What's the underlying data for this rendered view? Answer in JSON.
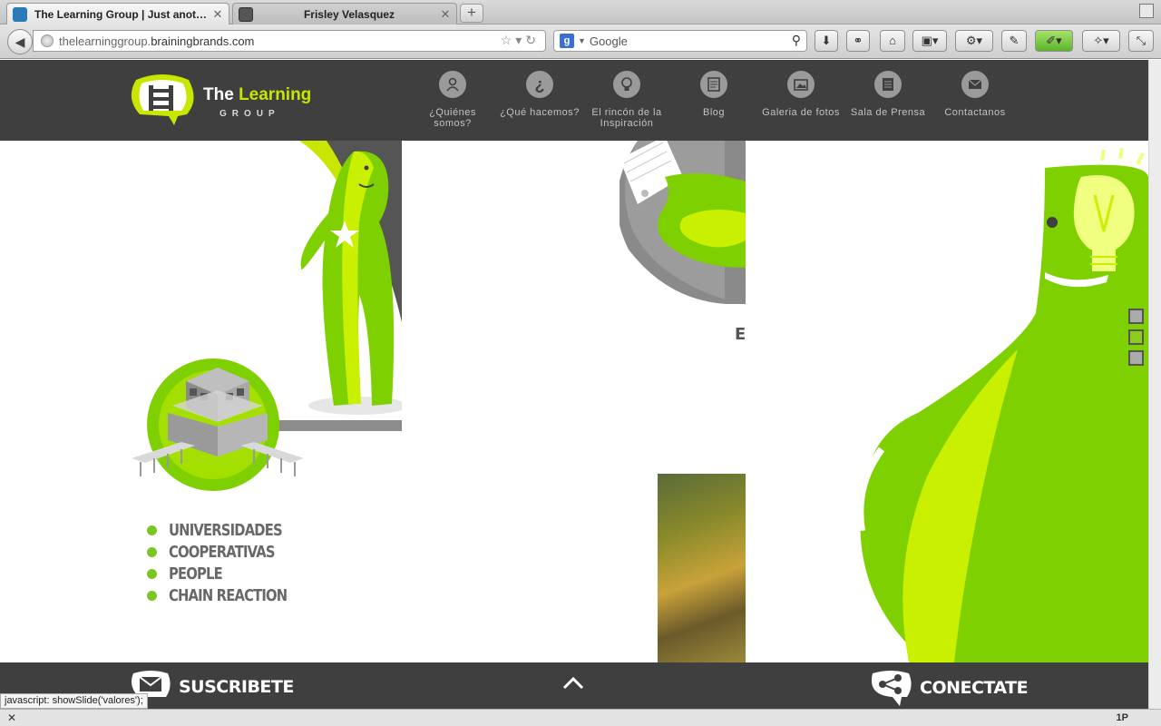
{
  "browser": {
    "tabs": [
      {
        "title": "The Learning Group | Just anot…",
        "active": true
      },
      {
        "title": "Frisley Velasquez",
        "active": false
      }
    ],
    "new_tab": "+",
    "url": {
      "prefix": "thelearninggroup.",
      "domain": "brainingbrands.com"
    },
    "search_placeholder": "Google",
    "status_link": "javascript: showSlide('valores');",
    "status_addon": "1P"
  },
  "site": {
    "brand_pre": "The ",
    "brand_highlight": "Learning",
    "brand_sub": "GROUP",
    "menu": [
      {
        "label": "¿Quiénes somos?",
        "icon": "user-icon"
      },
      {
        "label": "¿Qué hacemos?",
        "icon": "question-icon"
      },
      {
        "label": "El rincón de la Inspiración",
        "icon": "lightbulb-icon"
      },
      {
        "label": "Blog",
        "icon": "document-icon"
      },
      {
        "label": "Galeria de fotos",
        "icon": "photo-icon"
      },
      {
        "label": "Sala de Prensa",
        "icon": "newspaper-icon"
      },
      {
        "label": "Contactanos",
        "icon": "envelope-icon"
      }
    ],
    "partial_heading": "E",
    "bullets": [
      "UNIVERSIDADES",
      "COOPERATIVAS",
      "PEOPLE",
      "CHAIN REACTION"
    ],
    "slides": 3,
    "footer": {
      "subscribe": "SUSCRIBETE",
      "connect": "CONECTATE"
    }
  },
  "colors": {
    "header_bg": "#3f3f3f",
    "green": "#8ad400",
    "lime": "#c8f000",
    "bullet": "#7ac620",
    "text_gray": "#686868"
  }
}
